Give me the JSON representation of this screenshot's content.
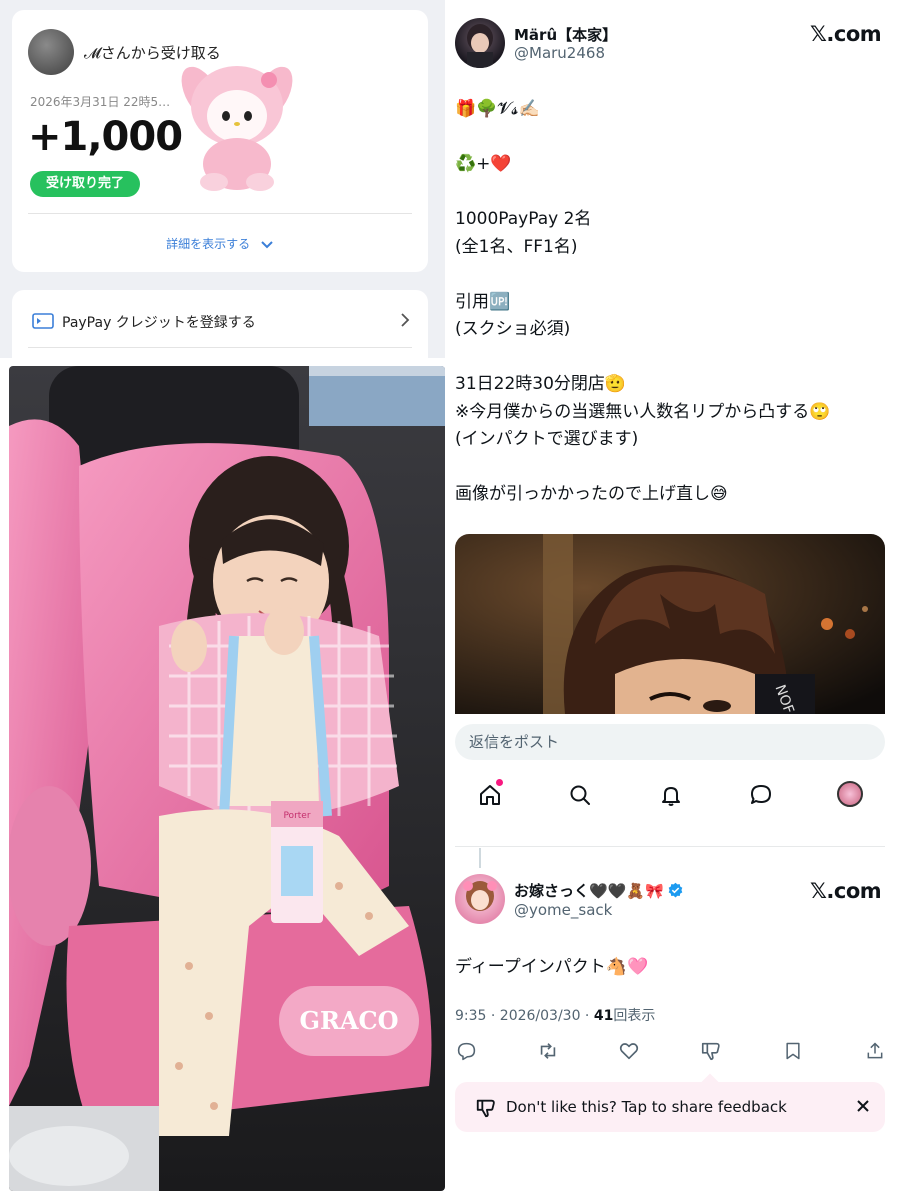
{
  "paypay": {
    "from_text": "𝓜さんから受け取る",
    "date": "2026年3月31日 22時5…",
    "amount": "+1,000",
    "status_badge": "受け取り完了",
    "details_link": "詳細を表示する",
    "credit_link": "PayPay クレジットを登録する"
  },
  "tweet1": {
    "display_name": "Märû【本家】",
    "handle": "@Maru2468",
    "source": "𝕏.com",
    "body": "🎁🌳𝓥𝓼✍🏻\n\n♻️+❤️\n\n1000PayPay 2名\n(全1名、FF1名)\n\n引用🆙\n(スクショ必須)\n\n31日22時30分閉店🫡\n※今月僕からの当選無い人数名リプから凸する🙄\n(インパクトで選びます)\n\n画像が引っかかったので上げ直し😅"
  },
  "reply_bar": {
    "placeholder": "返信をポスト"
  },
  "bottom_nav": [
    "home-icon",
    "search-icon",
    "notifications-icon",
    "messages-icon",
    "profile-avatar"
  ],
  "tweet2": {
    "display_name": "お嫁さっく🖤🖤🧸🎀",
    "handle": "@yome_sack",
    "source": "𝕏.com",
    "body": "ディープインパクト🐴🩷",
    "time": "9:35 · 2026/03/30 · ",
    "views_count": "41",
    "views_label": "回表示"
  },
  "tweet_actions": [
    "reply-icon",
    "repost-icon",
    "like-icon",
    "dislike-icon",
    "bookmark-icon",
    "share-icon"
  ],
  "feedback": {
    "text": "Don't like this? Tap to share feedback"
  },
  "photo": {
    "seat_brand": "GRACO",
    "carton_label": "Porter"
  },
  "colors": {
    "paypay_green": "#27c15e",
    "link_blue": "#3b7fd8",
    "x_pink": "#f91880",
    "verified_blue": "#1d9bf0",
    "feedback_bg": "#fdeff5"
  }
}
